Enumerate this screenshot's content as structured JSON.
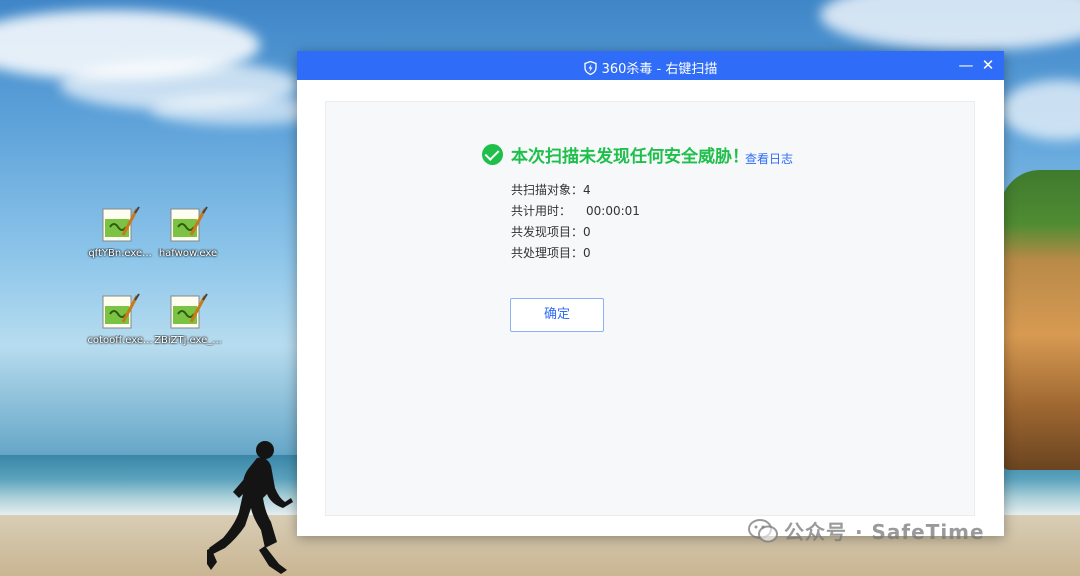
{
  "desktop": {
    "icons": [
      {
        "label": "qftYBn.exe..."
      },
      {
        "label": "hafwow.exe"
      },
      {
        "label": "cotooff.exe..."
      },
      {
        "label": "ZBiZTj.exe_..."
      }
    ]
  },
  "window": {
    "title": "360杀毒 - 右键扫描",
    "minimize_glyph": "—",
    "close_glyph": "✕"
  },
  "result": {
    "message": "本次扫描未发现任何安全威胁！",
    "log_link": "查看日志",
    "stats": [
      {
        "label": "共扫描对象：",
        "value": "4"
      },
      {
        "label": "共计用时：",
        "value": "00:00:01"
      },
      {
        "label": "共发现项目：",
        "value": "0"
      },
      {
        "label": "共处理项目：",
        "value": "0"
      }
    ],
    "confirm_button": "确定"
  },
  "watermark": {
    "text": "公众号 · SafeTime"
  },
  "colors": {
    "titlebar": "#2f6cf7",
    "success": "#1fbf4b",
    "link": "#2f6cf7"
  }
}
